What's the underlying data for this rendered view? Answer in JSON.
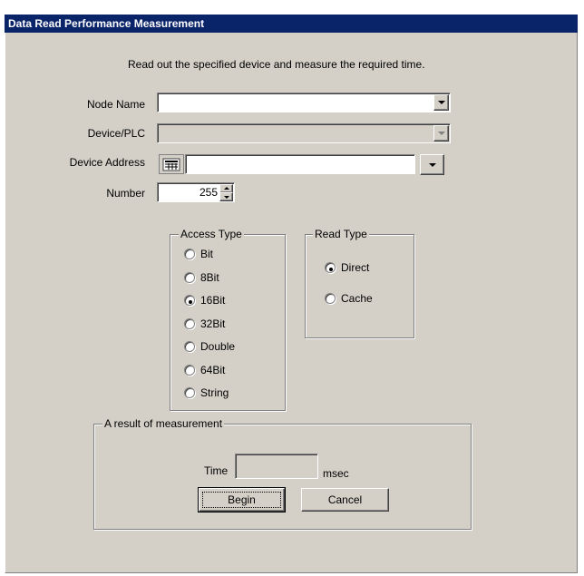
{
  "dialog": {
    "title": "Data Read Performance Measurement",
    "description": "Read out the specified device and measure the required time."
  },
  "form": {
    "node_name_label": "Node Name",
    "node_name_value": "",
    "device_plc_label": "Device/PLC",
    "device_plc_value": "",
    "device_address_label": "Device Address",
    "device_address_value": "",
    "number_label": "Number",
    "number_value": "255"
  },
  "access_type": {
    "legend": "Access Type",
    "options": [
      "Bit",
      "8Bit",
      "16Bit",
      "32Bit",
      "Double",
      "64Bit",
      "String"
    ],
    "selected": "16Bit"
  },
  "read_type": {
    "legend": "Read Type",
    "options": [
      "Direct",
      "Cache"
    ],
    "selected": "Direct"
  },
  "result": {
    "legend": "A result of measurement",
    "time_label": "Time",
    "time_value": "",
    "unit": "msec"
  },
  "buttons": {
    "begin": "Begin",
    "cancel": "Cancel"
  },
  "icons": {
    "device_address_icon": "grid-icon",
    "dropdown_icon": "chevron-down-icon"
  }
}
